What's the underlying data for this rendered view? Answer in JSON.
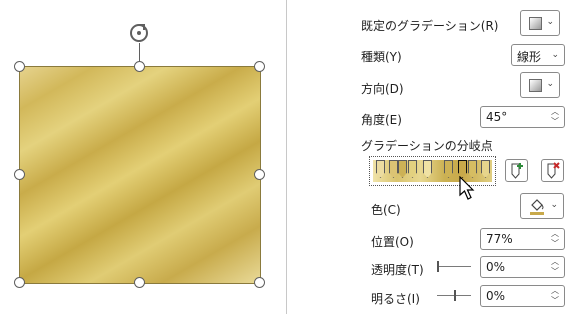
{
  "canvas": {
    "shape_gradient_colors": [
      "#e6d38e",
      "#d2b85a",
      "#c9ac4a",
      "#e9da98"
    ],
    "rotate_icon": "rotate-handle-icon"
  },
  "pane": {
    "preset_gradient": {
      "label": "既定のグラデーション(R)",
      "icon": "gradient-swatch-icon"
    },
    "type": {
      "label": "種類(Y)",
      "value": "線形"
    },
    "direction": {
      "label": "方向(D)",
      "icon": "gradient-swatch-icon"
    },
    "angle": {
      "label": "角度(E)",
      "value": "45°"
    },
    "gradient_stops": {
      "label": "グラデーションの分岐点",
      "add_icon": "add-gradient-stop-icon",
      "remove_icon": "remove-gradient-stop-icon"
    },
    "color": {
      "label": "色(C)",
      "icon": "paint-bucket-icon",
      "accent": "#c8a94a"
    },
    "position": {
      "label": "位置(O)",
      "value": "77%"
    },
    "transparency": {
      "label": "透明度(T)",
      "value": "0%",
      "slider_fraction": 0
    },
    "brightness": {
      "label": "明るさ(I)",
      "value": "0%",
      "slider_fraction": 0.5
    }
  }
}
